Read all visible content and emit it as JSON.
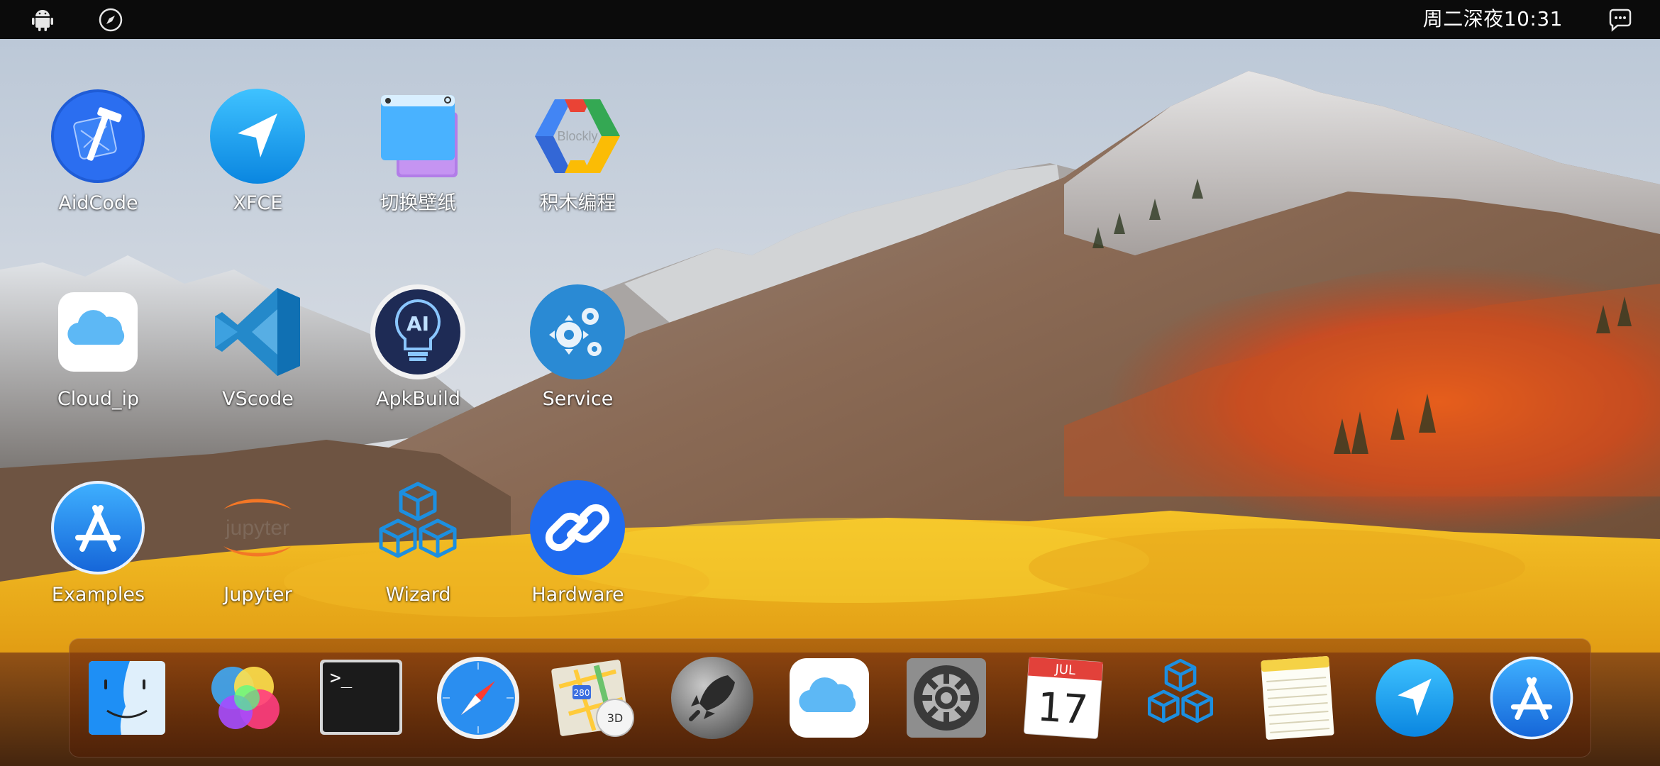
{
  "statusbar": {
    "left_icons": [
      "android-icon",
      "compass-icon"
    ],
    "time": "周二深夜10:31",
    "right_icons": [
      "chat-bubble-icon"
    ]
  },
  "desktop": {
    "icons": [
      {
        "label": "AidCode",
        "icon": "xcode-hammer-icon"
      },
      {
        "label": "XFCE",
        "icon": "paper-plane-icon"
      },
      {
        "label": "切换壁纸",
        "icon": "window-stack-icon"
      },
      {
        "label": "积木编程",
        "icon": "blockly-icon"
      },
      {
        "label": "Cloud_ip",
        "icon": "cloud-icon"
      },
      {
        "label": "VScode",
        "icon": "vscode-icon"
      },
      {
        "label": "ApkBuild",
        "icon": "ai-lightbulb-icon"
      },
      {
        "label": "Service",
        "icon": "gears-icon"
      },
      {
        "label": "Examples",
        "icon": "app-store-icon"
      },
      {
        "label": "Jupyter",
        "icon": "jupyter-icon"
      },
      {
        "label": "Wizard",
        "icon": "cubes-icon"
      },
      {
        "label": "Hardware",
        "icon": "link-icon"
      }
    ]
  },
  "dock": {
    "items": [
      {
        "icon": "finder-icon"
      },
      {
        "icon": "color-balls-icon"
      },
      {
        "icon": "terminal-icon",
        "text": ">_"
      },
      {
        "icon": "safari-compass-icon"
      },
      {
        "icon": "maps-icon",
        "text": "280"
      },
      {
        "icon": "launchpad-rocket-icon"
      },
      {
        "icon": "icloud-icon"
      },
      {
        "icon": "system-preferences-icon"
      },
      {
        "icon": "calendar-icon",
        "month": "JUL",
        "day": "17"
      },
      {
        "icon": "cubes-icon"
      },
      {
        "icon": "notes-icon"
      },
      {
        "icon": "paper-plane-icon"
      },
      {
        "icon": "app-store-icon"
      }
    ]
  }
}
